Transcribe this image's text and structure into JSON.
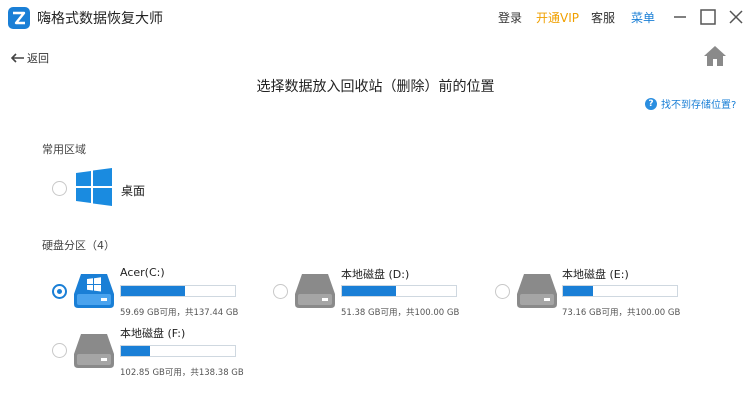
{
  "app": {
    "title": "嗨格式数据恢复大师",
    "login": "登录",
    "vip": "开通VIP",
    "service": "客服",
    "menu": "菜单"
  },
  "nav": {
    "back": "返回"
  },
  "page": {
    "title": "选择数据放入回收站（删除）前的位置",
    "help": "找不到存储位置?"
  },
  "common": {
    "header": "常用区域",
    "desktop": "桌面"
  },
  "drives": {
    "header": "硬盘分区（4）",
    "items": [
      {
        "name": "Acer(C:)",
        "size": "59.69 GB可用，共137.44 GB",
        "used_fraction": 0.56,
        "selected": true
      },
      {
        "name": "本地磁盘 (D:)",
        "size": "51.38 GB可用，共100.00 GB",
        "used_fraction": 0.47,
        "selected": false
      },
      {
        "name": "本地磁盘 (E:)",
        "size": "73.16 GB可用，共100.00 GB",
        "used_fraction": 0.26,
        "selected": false
      },
      {
        "name": "本地磁盘 (F:)",
        "size": "102.85 GB可用，共138.38 GB",
        "used_fraction": 0.25,
        "selected": false
      }
    ]
  },
  "colors": {
    "accent": "#1a7fd6",
    "vip": "#f0a000",
    "drive_gray": "#8a8a8a"
  }
}
